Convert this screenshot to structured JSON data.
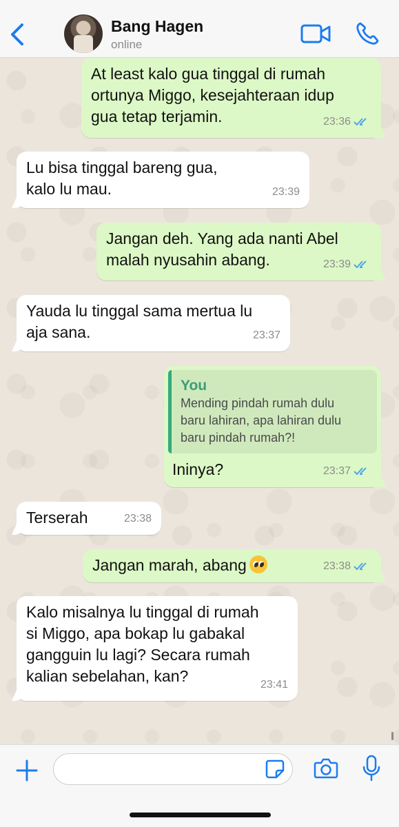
{
  "header": {
    "contact_name": "Bang Hagen",
    "status": "online"
  },
  "messages": [
    {
      "direction": "out",
      "text": "At least kalo gua tinggal di rumah\nortunya Miggo, kesejahteraan idup\ngua tetap terjamin.",
      "time": "23:36",
      "read": true
    },
    {
      "direction": "in",
      "text": "Lu bisa tinggal bareng gua,\nkalo lu mau.",
      "time": "23:39"
    },
    {
      "direction": "out",
      "text": "Jangan deh. Yang ada nanti Abel\nmalah nyusahin abang.",
      "time": "23:39",
      "read": true
    },
    {
      "direction": "in",
      "text": "Yauda lu tinggal sama mertua lu\naja sana.",
      "time": "23:37"
    },
    {
      "direction": "out",
      "quote": {
        "author": "You",
        "text": "Mending pindah rumah dulu\nbaru lahiran, apa lahiran dulu\nbaru pindah rumah?!"
      },
      "text": "Ininya?",
      "time": "23:37",
      "read": true
    },
    {
      "direction": "in",
      "text": "Terserah",
      "time": "23:38"
    },
    {
      "direction": "out",
      "text": "Jangan marah, abang",
      "emoji": "pleading-face",
      "time": "23:38",
      "read": true
    },
    {
      "direction": "in",
      "text": "Kalo misalnya lu tinggal di rumah\nsi Miggo, apa bokap lu gabakal\ngangguin lu lagi? Secara rumah\nkalian sebelahan, kan?",
      "time": "23:41"
    }
  ],
  "input": {
    "value": "",
    "placeholder": ""
  },
  "colors": {
    "accent": "#1a7cf0",
    "outgoing": "#dcf8c6",
    "incoming": "#ffffff",
    "read_ticks": "#4fa6e8"
  },
  "icons": {
    "back": "chevron-left-icon",
    "video": "video-camera-icon",
    "call": "phone-icon",
    "plus": "plus-icon",
    "sticker": "sticker-icon",
    "camera": "camera-icon",
    "mic": "microphone-icon"
  }
}
